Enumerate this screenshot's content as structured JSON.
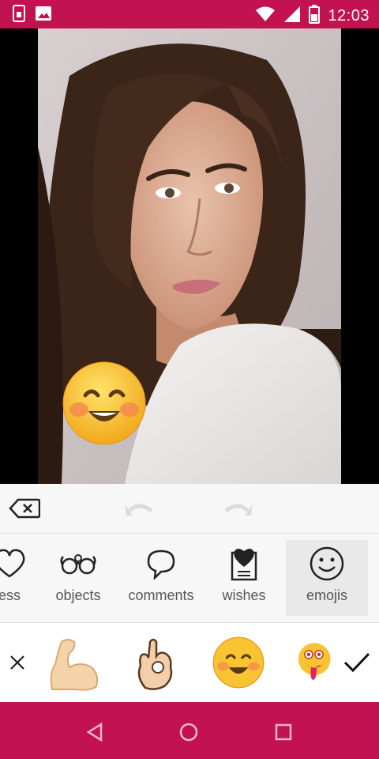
{
  "status_bar": {
    "time": "12:03",
    "left_icons": [
      "sim-card-icon",
      "image-icon"
    ],
    "right_icons": [
      "wifi-icon",
      "signal-icon",
      "battery-icon"
    ]
  },
  "colors": {
    "brand": "#c2124f",
    "panel": "#f7f7f7",
    "selected_tab": "#e9e9e9"
  },
  "toolbar": {
    "icons": [
      "backspace-icon",
      "undo-icon",
      "redo-icon"
    ]
  },
  "categories": [
    {
      "label": "ess",
      "icon": "heart-outline-icon"
    },
    {
      "label": "objects",
      "icon": "glasses-icon"
    },
    {
      "label": "comments",
      "icon": "speech-bubble-icon"
    },
    {
      "label": "wishes",
      "icon": "heart-card-icon"
    },
    {
      "label": "emojis",
      "icon": "smiley-icon",
      "selected": true
    }
  ],
  "sticker_strip": {
    "items": [
      "flexed-biceps-icon",
      "ok-hand-icon",
      "smiling-face-icon",
      "crazy-face-icon"
    ],
    "actions": [
      "close-icon",
      "check-icon"
    ]
  },
  "nav_bar": {
    "icons": [
      "back-icon",
      "home-icon",
      "recents-icon"
    ]
  }
}
